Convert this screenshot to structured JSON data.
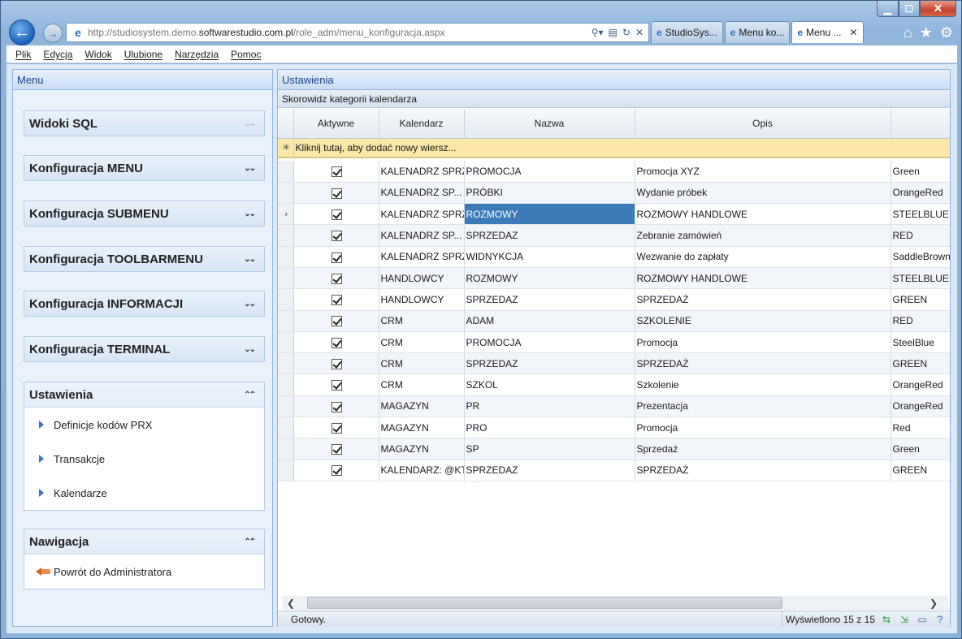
{
  "browser": {
    "url_prefix": "http://studiosystem.demo.",
    "url_domain": "softwarestudio.com.pl",
    "url_path": "/role_adm/menu_konfiguracja.aspx",
    "tabs": [
      {
        "label": "StudioSys...",
        "active": false
      },
      {
        "label": "Menu ko...",
        "active": false
      },
      {
        "label": "Menu ...",
        "active": true
      }
    ],
    "window_controls": {
      "min": "▁",
      "max": "☐",
      "close": "✕"
    }
  },
  "menubar": [
    "Plik",
    "Edycja",
    "Widok",
    "Ulubione",
    "Narzędzia",
    "Pomoc"
  ],
  "left_panel": {
    "title": "Menu",
    "sections": [
      {
        "title": "Widoki SQL",
        "expanded": false
      },
      {
        "title": "Konfiguracja MENU",
        "expanded": false
      },
      {
        "title": "Konfiguracja SUBMENU",
        "expanded": false
      },
      {
        "title": "Konfiguracja TOOLBARMENU",
        "expanded": false
      },
      {
        "title": "Konfiguracja INFORMACJI",
        "expanded": false
      },
      {
        "title": "Konfiguracja TERMINAL",
        "expanded": false
      },
      {
        "title": "Ustawienia",
        "expanded": true,
        "items": [
          "Definicje kodów PRX",
          "Transakcje",
          "Kalendarze"
        ]
      },
      {
        "title": "Nawigacja",
        "expanded": true,
        "items": [
          "Powrót do Administratora"
        ]
      }
    ]
  },
  "right_panel": {
    "title": "Ustawienia",
    "grid_caption": "Skorowidz kategorii kalendarza",
    "columns": [
      "Aktywne",
      "Kalendarz",
      "Nazwa",
      "Opis",
      ""
    ],
    "new_row_text": "Kliknij tutaj, aby dodać nowy wiersz...",
    "rows": [
      {
        "active": true,
        "kalendarz": "KALENADRZ SPRZEDAZY",
        "nazwa": "PROMOCJA",
        "opis": "Promocja XYZ",
        "kolor": "Green"
      },
      {
        "active": true,
        "kalendarz": "KALENADRZ SP...",
        "nazwa": "PRÓBKI",
        "opis": "Wydanie próbek",
        "kolor": "OrangeRed"
      },
      {
        "active": true,
        "kalendarz": "KALENADRZ SPRZEDAZY",
        "nazwa": "ROZMOWY",
        "opis": "ROZMOWY HANDLOWE",
        "kolor": "STEELBLUE"
      },
      {
        "active": true,
        "kalendarz": "KALENADRZ SP...",
        "nazwa": "SPRZEDAZ",
        "opis": "Zebranie zamówień",
        "kolor": "RED"
      },
      {
        "active": true,
        "kalendarz": "KALENADRZ SPRZEDAZY",
        "nazwa": "WIDNYKCJA",
        "opis": "Wezwanie do zapłaty",
        "kolor": "SaddleBrown"
      },
      {
        "active": true,
        "kalendarz": "HANDLOWCY",
        "nazwa": "ROZMOWY",
        "opis": "ROZMOWY HANDLOWE",
        "kolor": "STEELBLUE"
      },
      {
        "active": true,
        "kalendarz": "HANDLOWCY",
        "nazwa": "SPRZEDAZ",
        "opis": "SPRZEDAŻ",
        "kolor": "GREEN"
      },
      {
        "active": true,
        "kalendarz": "CRM",
        "nazwa": "ADAM",
        "opis": "SZKOLENIE",
        "kolor": "RED"
      },
      {
        "active": true,
        "kalendarz": "CRM",
        "nazwa": "PROMOCJA",
        "opis": "Promocja",
        "kolor": "SteelBlue"
      },
      {
        "active": true,
        "kalendarz": "CRM",
        "nazwa": "SPRZEDAZ",
        "opis": "SPRZEDAŻ",
        "kolor": "GREEN"
      },
      {
        "active": true,
        "kalendarz": "CRM",
        "nazwa": "SZKOL",
        "opis": "Szkolenie",
        "kolor": "OrangeRed"
      },
      {
        "active": true,
        "kalendarz": "MAGAZYN",
        "nazwa": "PR",
        "opis": "Prezentacja",
        "kolor": "OrangeRed"
      },
      {
        "active": true,
        "kalendarz": "MAGAZYN",
        "nazwa": "PRO",
        "opis": "Promocja",
        "kolor": "Red"
      },
      {
        "active": true,
        "kalendarz": "MAGAZYN",
        "nazwa": "SP",
        "opis": "Sprzedaż",
        "kolor": "Green"
      },
      {
        "active": true,
        "kalendarz": "KALENDARZ: @KTOS",
        "nazwa": "SPRZEDAZ",
        "opis": "SPRZEDAŻ",
        "kolor": "GREEN"
      }
    ],
    "current_row_index": 2,
    "status_left": "Gotowy.",
    "status_right": "Wyświetlono 15 z 15"
  }
}
